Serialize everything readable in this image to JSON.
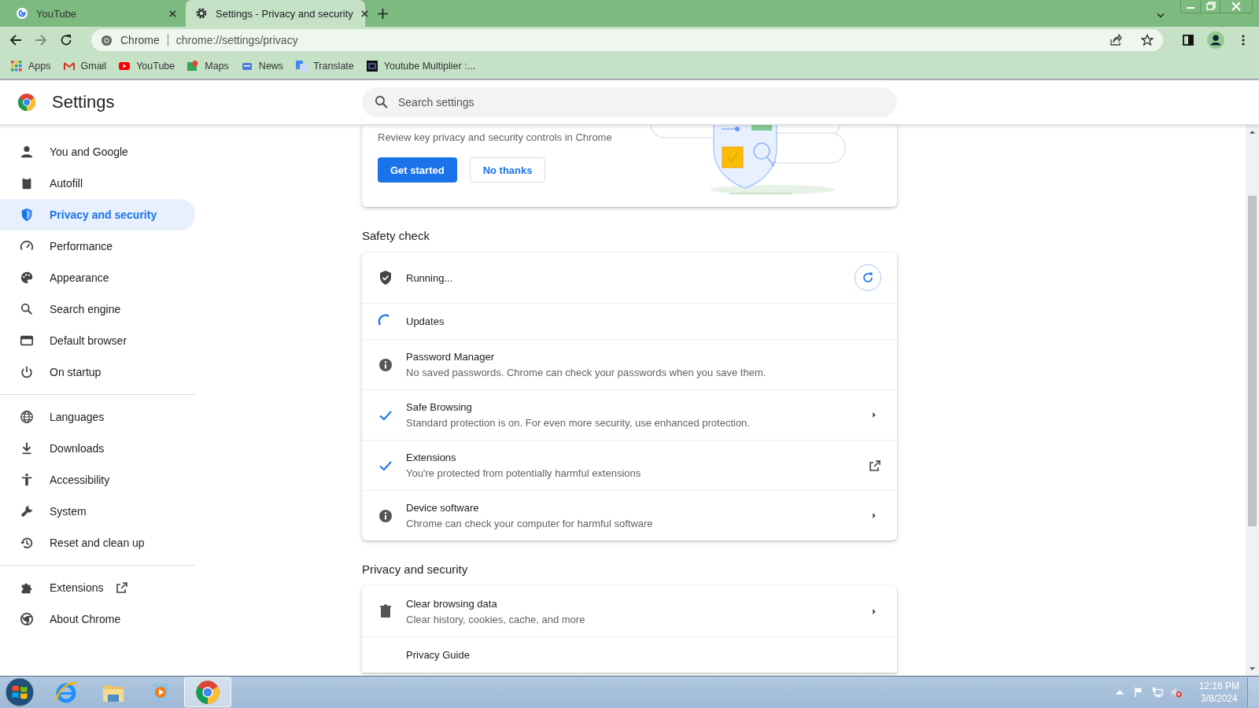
{
  "browser": {
    "tabs": [
      {
        "title": "YouTube",
        "selected": false
      },
      {
        "title": "Settings - Privacy and security",
        "selected": true
      }
    ],
    "address": {
      "site": "Chrome",
      "url": "chrome://settings/privacy"
    },
    "bookmarks": [
      {
        "label": "Apps"
      },
      {
        "label": "Gmail"
      },
      {
        "label": "YouTube"
      },
      {
        "label": "Maps"
      },
      {
        "label": "News"
      },
      {
        "label": "Translate"
      },
      {
        "label": "Youtube Multiplier :..."
      }
    ]
  },
  "header": {
    "title": "Settings",
    "search": {
      "placeholder": "Search settings"
    }
  },
  "sidebar": {
    "sections": [
      [
        {
          "label": "You and Google",
          "selected": false,
          "external": false
        },
        {
          "label": "Autofill",
          "selected": false,
          "external": false
        },
        {
          "label": "Privacy and security",
          "selected": true,
          "external": false
        },
        {
          "label": "Performance",
          "selected": false,
          "external": false
        },
        {
          "label": "Appearance",
          "selected": false,
          "external": false
        },
        {
          "label": "Search engine",
          "selected": false,
          "external": false
        },
        {
          "label": "Default browser",
          "selected": false,
          "external": false
        },
        {
          "label": "On startup",
          "selected": false,
          "external": false
        }
      ],
      [
        {
          "label": "Languages",
          "selected": false,
          "external": false
        },
        {
          "label": "Downloads",
          "selected": false,
          "external": false
        },
        {
          "label": "Accessibility",
          "selected": false,
          "external": false
        },
        {
          "label": "System",
          "selected": false,
          "external": false
        },
        {
          "label": "Reset and clean up",
          "selected": false,
          "external": false
        }
      ],
      [
        {
          "label": "Extensions",
          "selected": false,
          "external": true
        },
        {
          "label": "About Chrome",
          "selected": false,
          "external": false
        }
      ]
    ]
  },
  "privacy_guide_promo": {
    "text": "Review key privacy and security controls in Chrome",
    "buttons": [
      {
        "label": "Get started",
        "kind": "primary"
      },
      {
        "label": "No thanks",
        "kind": "secondary"
      }
    ]
  },
  "safety_check": {
    "heading": "Safety check",
    "rows": [
      {
        "kind": "running",
        "title": "Running...",
        "trailing": {
          "kind": "refresh"
        }
      },
      {
        "kind": "spinner",
        "title": "Updates"
      },
      {
        "kind": "info",
        "title": "Password Manager",
        "subtitle": "No saved passwords. Chrome can check your passwords when you save them."
      },
      {
        "kind": "check",
        "title": "Safe Browsing",
        "subtitle": "Standard protection is on. For even more security, use enhanced protection.",
        "trailing": {
          "kind": "arrow"
        }
      },
      {
        "kind": "check",
        "title": "Extensions",
        "subtitle": "You're protected from potentially harmful extensions",
        "trailing": {
          "kind": "external"
        }
      },
      {
        "kind": "info",
        "title": "Device software",
        "subtitle": "Chrome can check your computer for harmful software",
        "trailing": {
          "kind": "arrow"
        }
      }
    ]
  },
  "privacy_and_security": {
    "heading": "Privacy and security",
    "rows": [
      {
        "kind": "trash",
        "title": "Clear browsing data",
        "subtitle": "Clear history, cookies, cache, and more",
        "trailing": {
          "kind": "arrow"
        }
      },
      {
        "kind": "none",
        "title": "Privacy Guide"
      }
    ]
  },
  "taskbar": {
    "apps": [
      {
        "kind": "ie",
        "selected": false
      },
      {
        "kind": "folder",
        "selected": false
      },
      {
        "kind": "media",
        "selected": false
      },
      {
        "kind": "chrome",
        "selected": true
      }
    ],
    "time": "12:16 PM",
    "date": "3/8/2024"
  }
}
